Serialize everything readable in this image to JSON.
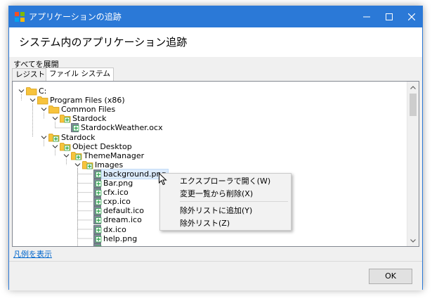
{
  "window": {
    "title": "アプリケーションの追跡",
    "heading": "システム内のアプリケーション追跡"
  },
  "toolbar": {
    "expand_all": "すべてを展開"
  },
  "tabs": [
    {
      "label": "レジストリ",
      "active": false
    },
    {
      "label": "ファイル システム",
      "active": true
    }
  ],
  "tree": [
    {
      "label": "C:",
      "depth": 0,
      "kind": "folder",
      "toggle": "open"
    },
    {
      "label": "Program Files (x86)",
      "depth": 1,
      "kind": "folder",
      "toggle": "open"
    },
    {
      "label": "Common Files",
      "depth": 2,
      "kind": "folder",
      "toggle": "open"
    },
    {
      "label": "Stardock",
      "depth": 3,
      "kind": "folder-tracked",
      "toggle": "open"
    },
    {
      "label": "StardockWeather.ocx",
      "depth": 4,
      "kind": "file"
    },
    {
      "label": "Stardock",
      "depth": 2,
      "kind": "folder-tracked",
      "toggle": "open"
    },
    {
      "label": "Object Desktop",
      "depth": 3,
      "kind": "folder-tracked",
      "toggle": "open"
    },
    {
      "label": "ThemeManager",
      "depth": 4,
      "kind": "folder-tracked",
      "toggle": "open"
    },
    {
      "label": "Images",
      "depth": 5,
      "kind": "folder-tracked",
      "toggle": "open"
    },
    {
      "label": "background.png",
      "depth": 6,
      "kind": "file",
      "selected": true
    },
    {
      "label": "Bar.png",
      "depth": 6,
      "kind": "file"
    },
    {
      "label": "cfx.ico",
      "depth": 6,
      "kind": "file"
    },
    {
      "label": "cxp.ico",
      "depth": 6,
      "kind": "file"
    },
    {
      "label": "default.ico",
      "depth": 6,
      "kind": "file"
    },
    {
      "label": "dream.ico",
      "depth": 6,
      "kind": "file"
    },
    {
      "label": "dx.ico",
      "depth": 6,
      "kind": "file"
    },
    {
      "label": "help.png",
      "depth": 6,
      "kind": "file"
    },
    {
      "label": "",
      "depth": 6,
      "kind": "file"
    }
  ],
  "context_menu": {
    "items": [
      "エクスプローラで開く(W)",
      "変更一覧から削除(X)",
      "除外リストに追加(Y)",
      "除外リスト(Z)"
    ]
  },
  "legend_link": "凡例を表示",
  "ok_label": "OK",
  "colors": {
    "titlebar": "#2b79d7",
    "folder": "#f7c33c",
    "tracked_badge": "#2fa84f",
    "file": "#7d8a95",
    "selection": "#dcebfc",
    "link": "#0066cc"
  }
}
